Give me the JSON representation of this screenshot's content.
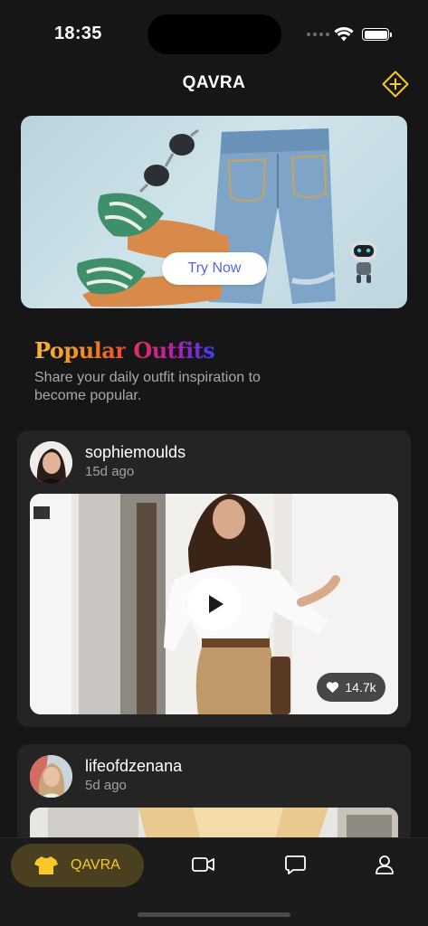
{
  "status_bar": {
    "time": "18:35"
  },
  "header": {
    "title": "QAVRA"
  },
  "banner": {
    "button_label": "Try Now"
  },
  "section": {
    "title_word1": "Popular",
    "title_word2": "Outfits",
    "subtitle": "Share your daily outfit inspiration to become popular."
  },
  "posts": [
    {
      "username": "sophiemoulds",
      "time_ago": "15d ago",
      "likes": "14.7k"
    },
    {
      "username": "lifeofdzenana",
      "time_ago": "5d ago"
    }
  ],
  "tab_bar": {
    "home_label": "QAVRA",
    "accent": "#f7c928",
    "icons": [
      "tshirt-icon",
      "video-camera-icon",
      "chat-bubble-icon",
      "profile-icon"
    ]
  }
}
